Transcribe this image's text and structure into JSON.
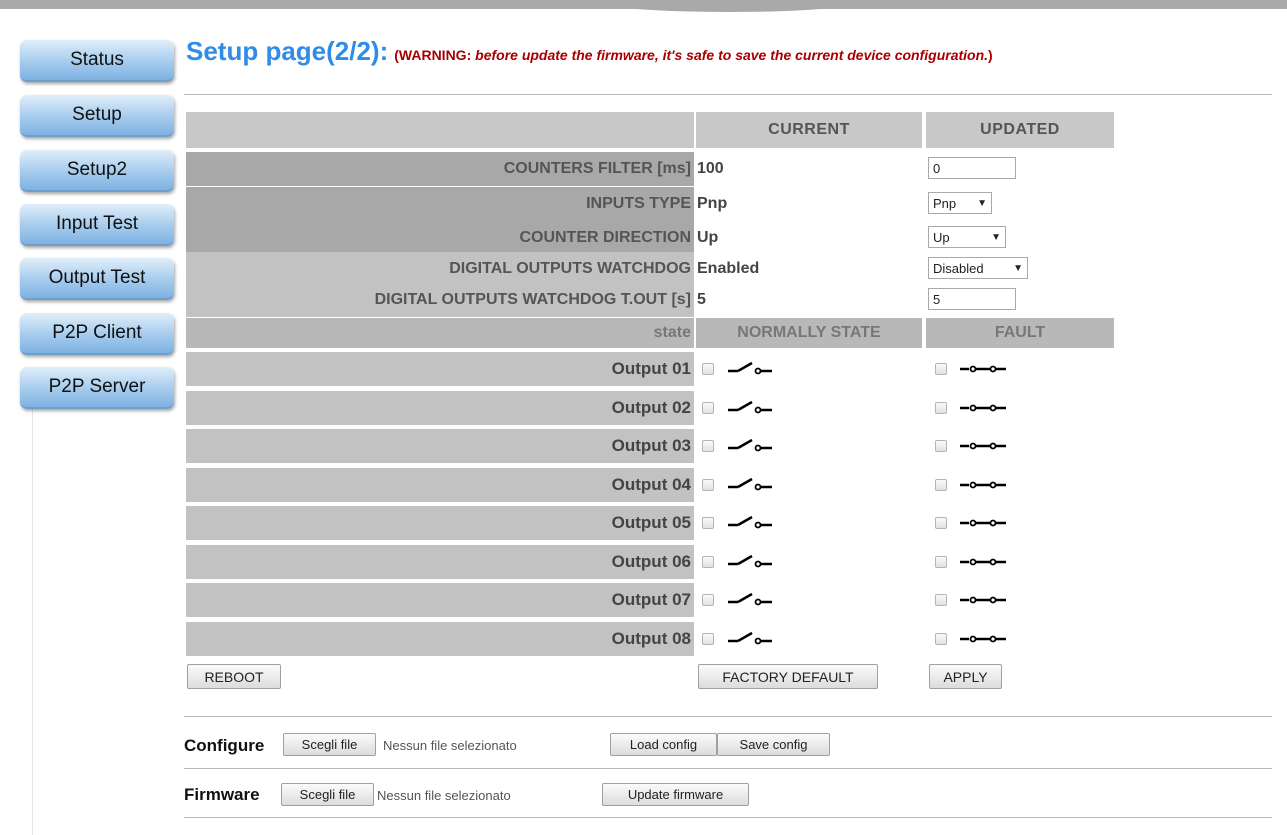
{
  "nav": {
    "items": [
      "Status",
      "Setup",
      "Setup2",
      "Input Test",
      "Output Test",
      "P2P Client",
      "P2P Server"
    ]
  },
  "header": {
    "title": "Setup page(2/2):",
    "warning_prefix": "(WARNING: ",
    "warning_body": "before update the firmware, it's safe to save the current device configuration.",
    "warning_suffix": ")"
  },
  "table": {
    "col_current": "CURRENT",
    "col_updated": "UPDATED",
    "rows": [
      {
        "label": "COUNTERS FILTER [ms]",
        "current": "100",
        "updated": "0"
      },
      {
        "label": "INPUTS TYPE",
        "current": "Pnp",
        "updated": "Pnp"
      },
      {
        "label": "COUNTER DIRECTION",
        "current": "Up",
        "updated": "Up"
      },
      {
        "label": "DIGITAL OUTPUTS WATCHDOG",
        "current": "Enabled",
        "updated": "Disabled"
      },
      {
        "label": "DIGITAL OUTPUTS WATCHDOG T.OUT [s]",
        "current": "5",
        "updated": "5"
      }
    ],
    "state_label": "state",
    "normally_state": "NORMALLY STATE",
    "fault": "FAULT",
    "outputs": [
      "Output 01",
      "Output 02",
      "Output 03",
      "Output 04",
      "Output 05",
      "Output 06",
      "Output 07",
      "Output 08"
    ]
  },
  "buttons": {
    "reboot": "REBOOT",
    "factory_default": "FACTORY DEFAULT",
    "apply": "APPLY"
  },
  "files": {
    "configure_label": "Configure",
    "firmware_label": "Firmware",
    "choose_file": "Scegli file",
    "no_file": "Nessun file selezionato",
    "load_config": "Load config",
    "save_config": "Save config",
    "update_firmware": "Update firmware"
  },
  "colors": {
    "title_blue": "#2f8ce7",
    "warning_red": "#a80000",
    "nav_blue": "#a5cbed"
  },
  "icons": {
    "normally_state": "switch-open-icon",
    "fault": "switch-closed-icon"
  }
}
